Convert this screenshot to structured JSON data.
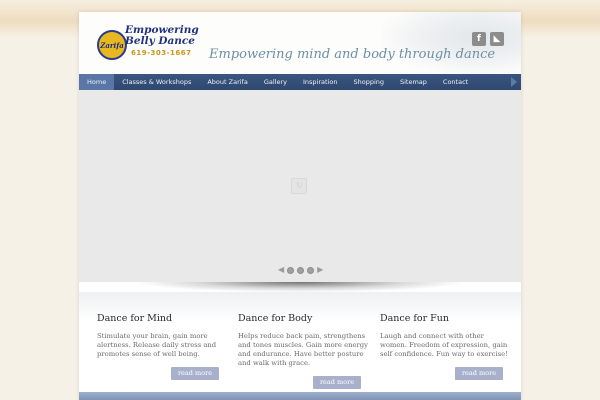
{
  "header": {
    "logo": {
      "badge_text": "Zarifa",
      "title": "Empowering Belly Dance",
      "phone": "619-303-1667"
    },
    "tagline": "Empowering mind and body through dance",
    "social": [
      {
        "name": "facebook",
        "glyph": "f",
        "icon": "facebook-icon"
      },
      {
        "name": "rss",
        "glyph": "◣",
        "icon": "rss-icon"
      }
    ]
  },
  "nav": {
    "items": [
      {
        "label": "Home",
        "active": true
      },
      {
        "label": "Classes & Workshops",
        "active": false
      },
      {
        "label": "About Zarifa",
        "active": false
      },
      {
        "label": "Gallery",
        "active": false
      },
      {
        "label": "Inspiration",
        "active": false
      },
      {
        "label": "Shopping",
        "active": false
      },
      {
        "label": "Sitemap",
        "active": false
      },
      {
        "label": "Contact",
        "active": false
      }
    ]
  },
  "slider": {
    "dots": 3,
    "loader_glyph": "↻",
    "prev_glyph": "◀",
    "next_glyph": "▶"
  },
  "columns": [
    {
      "title": "Dance for Mind",
      "text": "Stimulate your brain, gain more alertness.  Release daily stress and promotes sense of well being.",
      "button": "read more"
    },
    {
      "title": "Dance for Body",
      "text": "Helps reduce back pain, strengthens and tones muscles.  Gain more energy and endurance.  Have better posture and walk with grace.",
      "button": "read more"
    },
    {
      "title": "Dance for Fun",
      "text": "Laugh and connect with other women.  Freedom of expression, gain self confidence.  Fun way to exercise!",
      "button": "read more"
    }
  ],
  "colors": {
    "nav_bg": "#2e4870",
    "nav_active": "#5a76a6",
    "button_bg": "#a8b0cc",
    "tagline": "#6d8fa8",
    "logo_blue": "#22317f",
    "logo_gold": "#c8961a"
  }
}
